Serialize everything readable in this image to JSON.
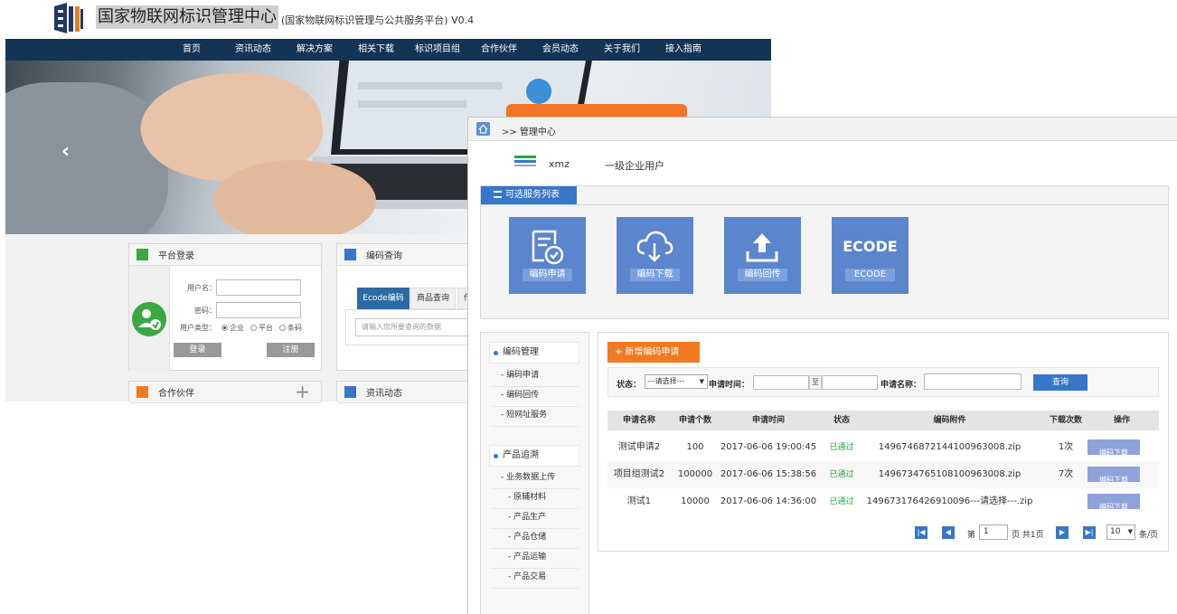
{
  "back": {
    "site_title": "国家物联网标识管理中心",
    "site_subtitle": "(国家物联网标识管理与公共服务平台) V0.4",
    "nav": [
      "首页",
      "资讯动态",
      "解决方案",
      "相关下载",
      "标识项目组",
      "合作伙伴",
      "会员动态",
      "关于我们",
      "接入指南"
    ],
    "login": {
      "title": "平台登录",
      "username_label": "用户名：",
      "password_label": "密码：",
      "type_label": "用户类型：",
      "types": [
        "企业",
        "平台",
        "条码"
      ],
      "selected_type": "企业",
      "login_btn": "登录",
      "register_btn": "注册"
    },
    "query": {
      "title": "编码查询",
      "tabs": [
        "Ecode编码",
        "商品查询",
        "传"
      ],
      "placeholder": "请输入您所要查询的数据"
    },
    "partners": {
      "title": "合作伙伴"
    },
    "news": {
      "title": "资讯动态"
    }
  },
  "front": {
    "breadcrumb": ">> 管理中心",
    "user": {
      "name": "xmz",
      "level": "一级企业用户"
    },
    "services": {
      "title": "可选服务列表",
      "cards": [
        {
          "label": "编码申请",
          "icon": "document-check-icon"
        },
        {
          "label": "编码下载",
          "icon": "cloud-download-icon"
        },
        {
          "label": "编码回传",
          "icon": "upload-tray-icon"
        },
        {
          "label": "ECODE",
          "big": "ECODE",
          "icon": "ecode-text"
        }
      ]
    },
    "sidebar": {
      "group1": "编码管理",
      "group1_items": [
        "编码申请",
        "编码回传",
        "短网址服务"
      ],
      "group2": "产品追溯",
      "group2_items": [
        "业务数据上传",
        "原辅材料",
        "产品生产",
        "产品仓储",
        "产品运输",
        "产品交易"
      ]
    },
    "toolbar": {
      "add_label": "新增编码申请",
      "status_label": "状态：",
      "status_value": "---请选择---",
      "time_label": "申请时间：",
      "range_sep": "至",
      "name_label": "申请名称：",
      "search_label": "查询"
    },
    "table": {
      "headers": [
        "申请名称",
        "申请个数",
        "申请时间",
        "状态",
        "编码附件",
        "下载次数",
        "操作"
      ],
      "rows": [
        {
          "name": "测试申请2",
          "count": "100",
          "time": "2017-06-06 19:00:45",
          "status": "已通过",
          "file": "1496746872144100963008.zip",
          "downloads": "1次",
          "action": "编码下载"
        },
        {
          "name": "项目组测试2",
          "count": "100000",
          "time": "2017-06-06 15:38:56",
          "status": "已通过",
          "file": "1496734765108100963008.zip",
          "downloads": "7次",
          "action": "编码下载"
        },
        {
          "name": "测试1",
          "count": "10000",
          "time": "2017-06-06 14:36:00",
          "status": "已通过",
          "file": "149673176426910096---请选择---.zip",
          "downloads": "",
          "action": "编码下载"
        }
      ]
    },
    "pager": {
      "first": "K",
      "prev": "◀",
      "next": "▶",
      "last": "▶|",
      "page_prefix": "第",
      "page": "1",
      "page_suffix": "页 共1页",
      "per_page": "10",
      "per_page_suffix": "条/页"
    }
  },
  "colors": {
    "nav_bg": "#143456",
    "primary": "#3876c9",
    "card": "#5b85cc",
    "orange": "#f07a22",
    "ok_green": "#2aa33d",
    "action_btn": "#8fa3d9"
  }
}
